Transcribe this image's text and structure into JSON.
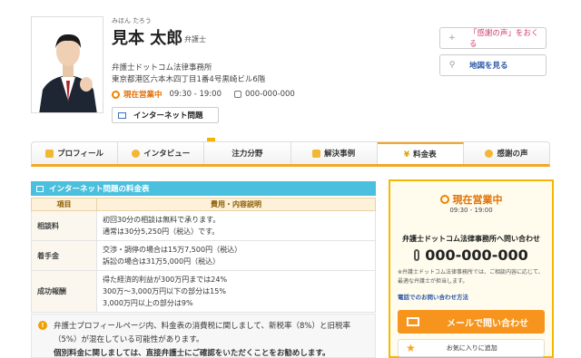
{
  "profile": {
    "ruby": "みほん たろう",
    "name": "見本 太郎",
    "role": "弁護士",
    "firm": "弁護士ドットコム法律事務所",
    "address": "東京都港区六本木四丁目1番4号黒崎ビル6階",
    "status": "現在営業中",
    "hours": "09:30 - 19:00",
    "phone": "000-000-000",
    "tag": "インターネット問題"
  },
  "side": {
    "thanks_btn": "「感謝の声」をおくる",
    "map_btn": "地図を見る"
  },
  "tabs": [
    {
      "label": "プロフィール"
    },
    {
      "label": "インタビュー"
    },
    {
      "label": "注力分野"
    },
    {
      "label": "解決事例"
    },
    {
      "label": "料金表"
    },
    {
      "label": "感謝の声"
    }
  ],
  "fee": {
    "heading": "インターネット問題の料金表",
    "col_item": "項目",
    "col_desc": "費用・内容説明",
    "rows": [
      {
        "item": "相談料",
        "lines": [
          "初回30分の相談は無料で承ります。",
          "通常は30分5,250円（税込）です。"
        ]
      },
      {
        "item": "着手金",
        "lines": [
          "交渉・調停の場合は15万7,500円（税込）",
          "訴訟の場合は31万5,000円（税込）"
        ]
      },
      {
        "item": "成功報酬",
        "lines": [
          "得た経済的利益が300万円までは24%",
          "300万～3,000万円以下の部分は15%",
          "3,000万円以上の部分は9%"
        ]
      }
    ]
  },
  "notice": {
    "line1": "弁護士プロフィールページ内、料金表の消費税に関しまして、新税率（8%）と旧税率",
    "line2": "（5%）が混在している可能性があります。",
    "line3": "個別料金に関しましては、直接弁護士にご確認をいただくことをお勧めします。"
  },
  "panel": {
    "status": "現在営業中",
    "hours": "09:30 - 19:00",
    "lead": "弁護士ドットコム法律事務所へ問い合わせ",
    "tel": "000-000-000",
    "note": "※弁護士ドットコム法律事務所では、ご相談内容に応じて、最適な弁護士が担当します。",
    "link": "電話でのお問い合わせ方法",
    "mail_btn": "メールで問い合わせ",
    "fav_btn": "お気に入りに追加"
  }
}
